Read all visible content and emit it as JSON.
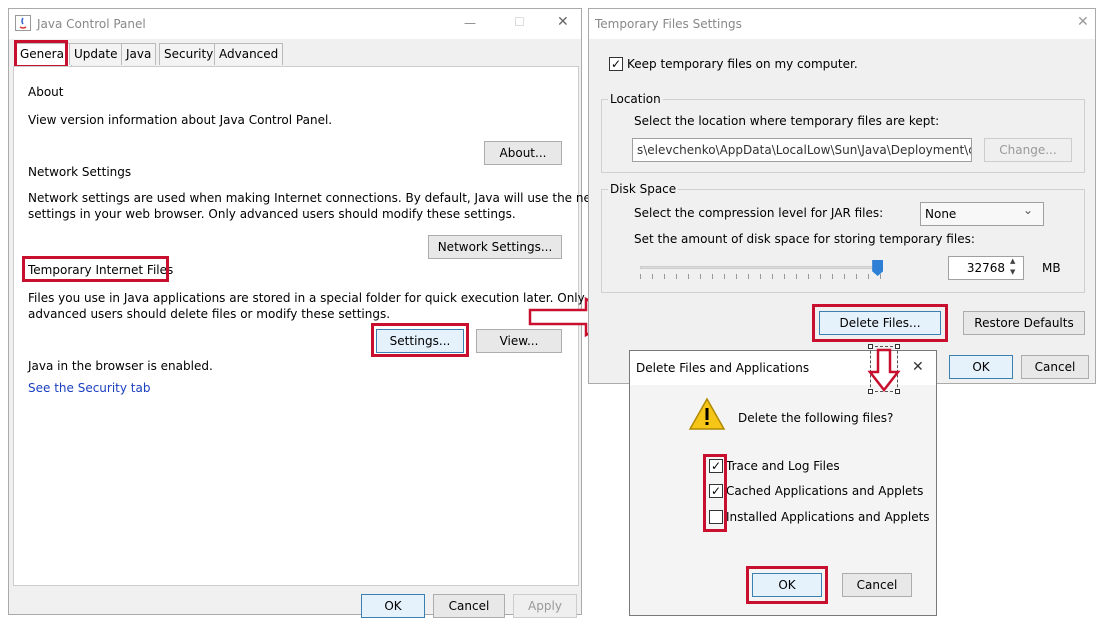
{
  "jcp": {
    "title": "Java Control Panel",
    "tabs": [
      "General",
      "Update",
      "Java",
      "Security",
      "Advanced"
    ],
    "about_heading": "About",
    "about_text": "View version information about Java Control Panel.",
    "about_button": "About...",
    "network_heading": "Network Settings",
    "network_text_1": "Network settings are used when making Internet connections. By default, Java will use the network",
    "network_text_2": "settings in your web browser. Only advanced users should modify these settings.",
    "network_button": "Network Settings...",
    "temp_heading": "Temporary Internet Files",
    "temp_text_1": "Files you use in Java applications are stored in a special folder for quick execution later. Only",
    "temp_text_2": "advanced users should delete files or modify these settings.",
    "settings_button": "Settings...",
    "view_button": "View...",
    "browser_text": "Java in the browser is enabled.",
    "security_link": "See the Security tab",
    "ok_button": "OK",
    "cancel_button": "Cancel",
    "apply_button": "Apply"
  },
  "tfs": {
    "title": "Temporary Files Settings",
    "keep_label": "Keep temporary files on my computer.",
    "location_label": "Location",
    "location_text": "Select the location where temporary files are kept:",
    "location_path": "s\\elevchenko\\AppData\\LocalLow\\Sun\\Java\\Deployment\\cache",
    "change_button": "Change...",
    "disk_label": "Disk Space",
    "compression_text": "Select the compression level for JAR files:",
    "compression_value": "None",
    "amount_text": "Set the amount of disk space for storing temporary files:",
    "disk_value": "32768",
    "disk_unit": "MB",
    "disk_slider_fraction": 0.98,
    "delete_button": "Delete Files...",
    "restore_button": "Restore Defaults",
    "ok_button": "OK",
    "cancel_button": "Cancel"
  },
  "dfa": {
    "title": "Delete Files and Applications",
    "prompt": "Delete the following files?",
    "options": [
      {
        "label": "Trace and Log Files",
        "checked": true
      },
      {
        "label": "Cached Applications and Applets",
        "checked": true
      },
      {
        "label": "Installed Applications and Applets",
        "checked": false
      }
    ],
    "ok_button": "OK",
    "cancel_button": "Cancel"
  },
  "icons": {
    "check_mark": "✓",
    "close": "✕",
    "minimize": "—",
    "maximize": "☐",
    "chevron": "⌄",
    "spinner_up": "▲",
    "spinner_down": "▼"
  },
  "colors": {
    "highlight_red": "#c8102e",
    "link_blue": "#1a3fbf",
    "warning_yellow": "#f5c518"
  }
}
